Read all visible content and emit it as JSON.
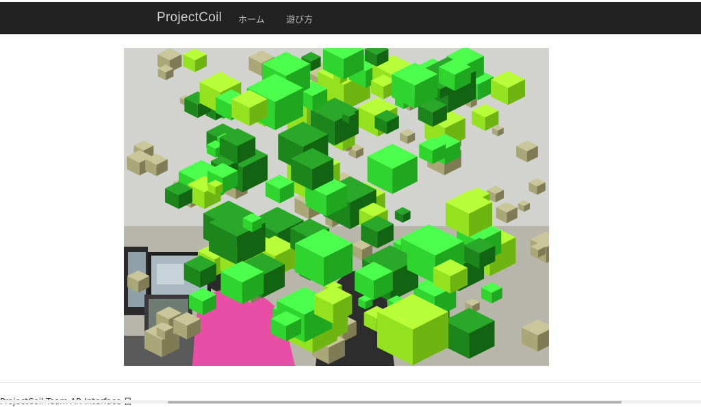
{
  "navbar": {
    "brand": "ProjectCoil",
    "links": [
      {
        "label": "ホーム"
      },
      {
        "label": "遊び方"
      }
    ]
  },
  "hero": {
    "kind": "photo of people at computers with AR green cube overlay"
  },
  "footer": {
    "text": "ProjectCoil Team AR Interface 日"
  },
  "colors": {
    "navbar_bg": "#222222",
    "brand_text": "#cfcfcf",
    "link_text": "#b9b9b9",
    "cube_bright": "#3df03d",
    "cube_lime": "#aaff2a",
    "cube_dark": "#138a13"
  }
}
